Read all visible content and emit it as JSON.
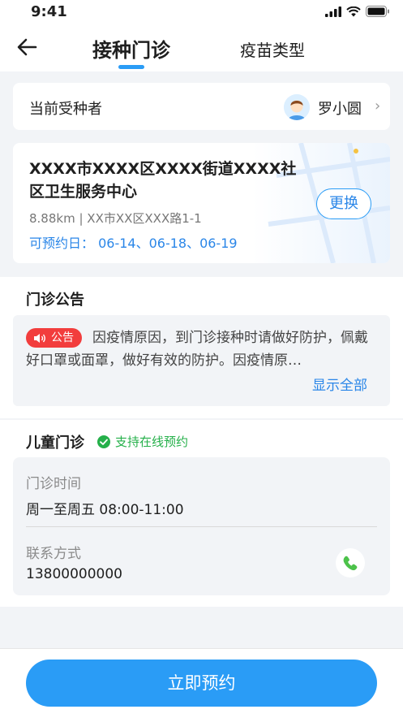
{
  "status": {
    "time": "9:41"
  },
  "header": {
    "tabs": [
      {
        "label": "接种门诊"
      },
      {
        "label": "疫苗类型"
      }
    ]
  },
  "recipient": {
    "label": "当前受种者",
    "name": "罗小圆"
  },
  "clinic": {
    "name": "XXXX市XXXX区XXXX街道XXXX社区卫生服务中心",
    "address": "8.88km | XX市XX区XXX路1-1",
    "dates": "可预约日： 06-14、06-18、06-19",
    "change_label": "更换"
  },
  "notice": {
    "title": "门诊公告",
    "badge": "公告",
    "text": "因疫情原因，到门诊接种时请做好防护，佩戴好口罩或面罩，做好有效的防护。因疫情原…",
    "show_all": "显示全部"
  },
  "outpatient": {
    "title": "儿童门诊",
    "online_tag": "支持在线预约",
    "hours_label": "门诊时间",
    "hours_value": "周一至周五 08:00-11:00",
    "contact_label": "联系方式",
    "contact_value": "13800000000"
  },
  "action": {
    "book_label": "立即预约"
  },
  "colors": {
    "accent": "#2a9cf6",
    "link": "#2a86e8",
    "alert": "#f23d3d",
    "success": "#25b04a"
  }
}
